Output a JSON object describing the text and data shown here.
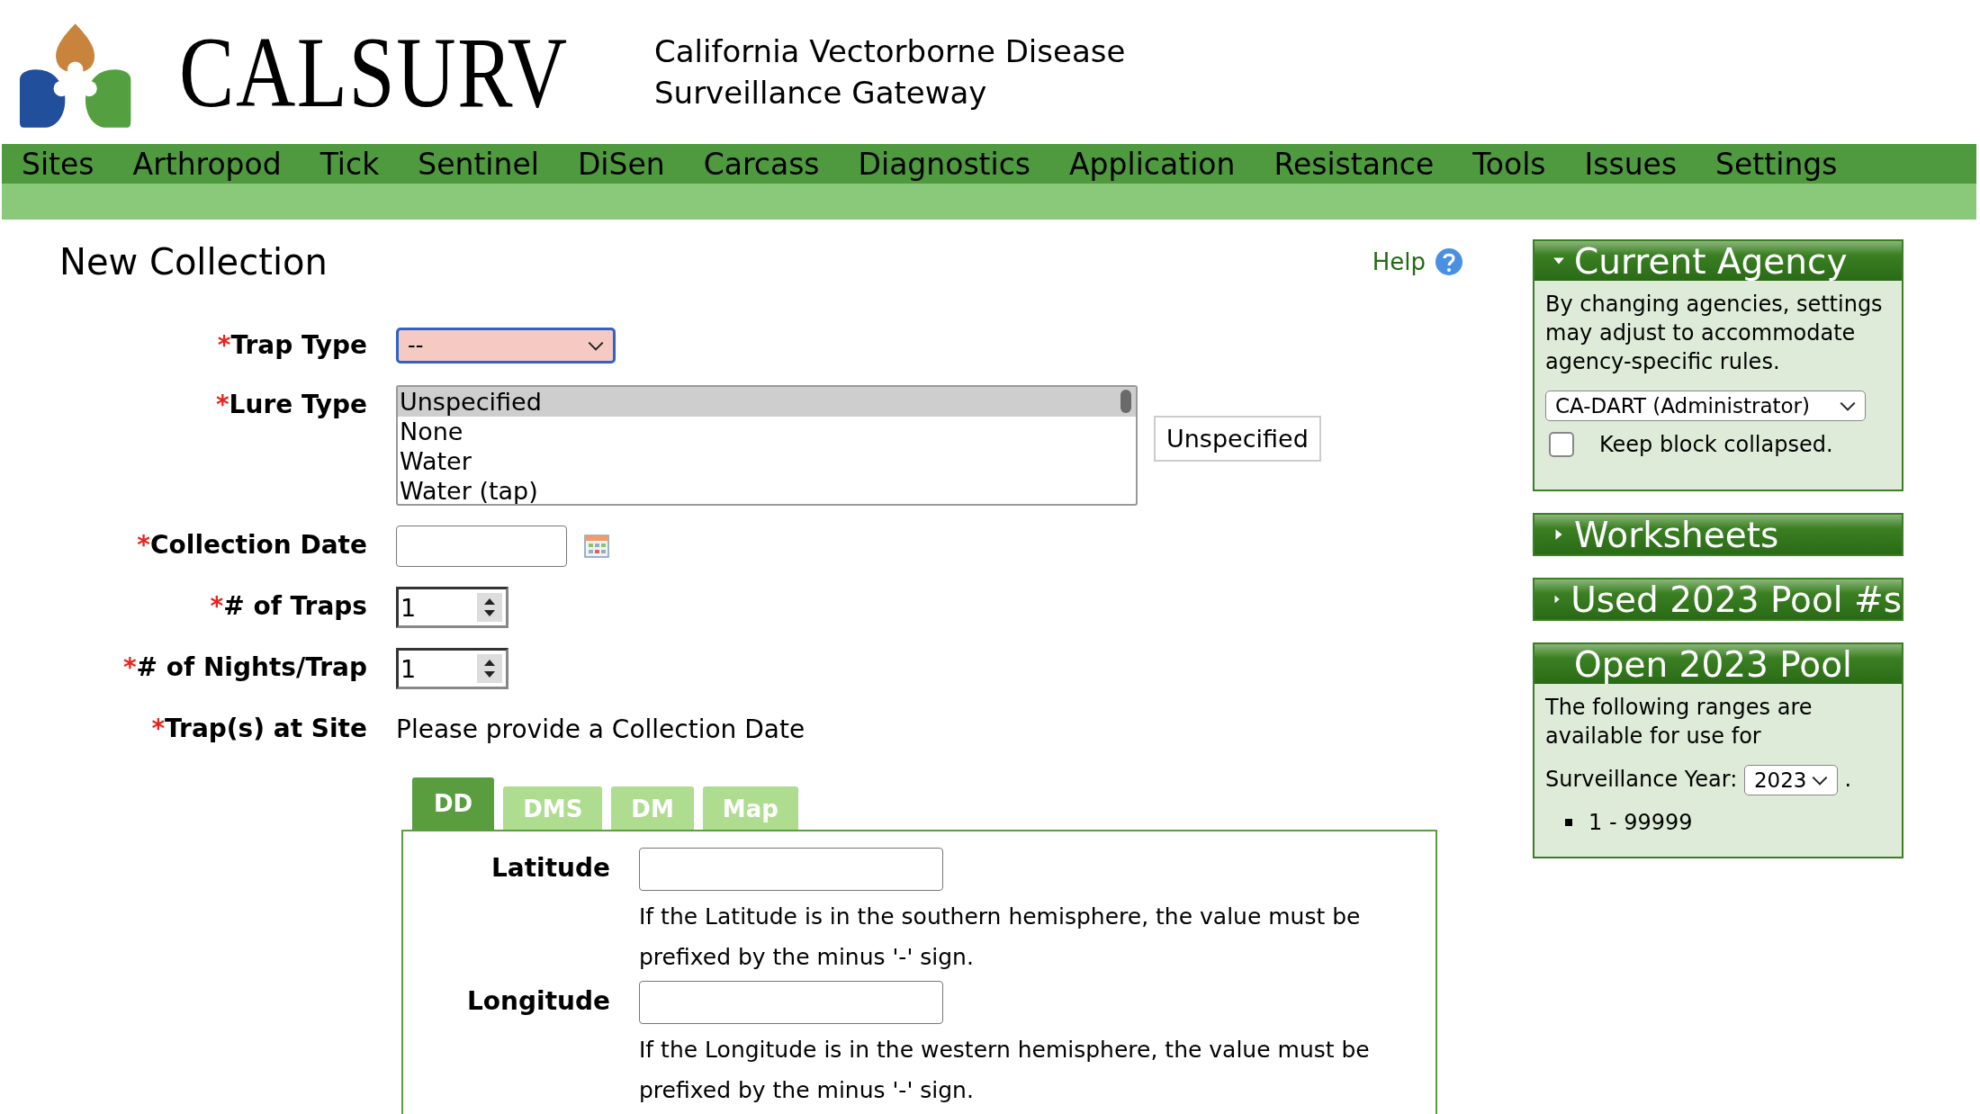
{
  "header": {
    "logo_text": "CALSURV",
    "subtitle_lines": [
      "California Vectorborne Disease",
      "Surveillance Gateway"
    ]
  },
  "nav": [
    {
      "label": "Sites"
    },
    {
      "label": "Arthropod"
    },
    {
      "label": "Tick"
    },
    {
      "label": "Sentinel"
    },
    {
      "label": "DiSen"
    },
    {
      "label": "Carcass"
    },
    {
      "label": "Diagnostics"
    },
    {
      "label": "Application"
    },
    {
      "label": "Resistance"
    },
    {
      "label": "Tools"
    },
    {
      "label": "Issues"
    },
    {
      "label": "Settings"
    }
  ],
  "page": {
    "title": "New Collection",
    "help": "Help"
  },
  "form": {
    "required_mark": "*",
    "trap_type": {
      "label": "Trap Type",
      "value": "--",
      "invalid": true
    },
    "lure_type": {
      "label": "Lure Type",
      "options": [
        {
          "label": "Unspecified",
          "selected": true
        },
        {
          "label": "None",
          "selected": false
        },
        {
          "label": "Water",
          "selected": false
        },
        {
          "label": "Water (tap)",
          "selected": false
        }
      ],
      "button": "Unspecified"
    },
    "collection_date": {
      "label": "Collection Date"
    },
    "traps": {
      "label": "# of Traps",
      "value": "1"
    },
    "nights": {
      "label": "# of Nights/Trap",
      "value": "1"
    },
    "traps_at_site": {
      "label": "Trap(s) at Site",
      "message": "Please provide a Collection Date"
    }
  },
  "coord_tabs": [
    {
      "label": "DD",
      "selected": true
    },
    {
      "label": "DMS",
      "selected": false
    },
    {
      "label": "DM",
      "selected": false
    },
    {
      "label": "Map",
      "selected": false
    }
  ],
  "coords": [
    {
      "label": "Latitude",
      "help": "If the Latitude is in the southern hemisphere, the value must be prefixed by the minus '-' sign."
    },
    {
      "label": "Longitude",
      "help": "If the Longitude is in the western hemisphere, the value must be prefixed by the minus '-' sign."
    }
  ],
  "sidebar": [
    {
      "kind": "agency",
      "title": "Current Agency",
      "expanded": true,
      "text": "By changing agencies, settings may adjust to accommodate agency-specific rules.",
      "select": "CA-DART (Administrator)",
      "checkbox": {
        "label": "Keep block collapsed.",
        "checked": false
      }
    },
    {
      "kind": "collapsed",
      "title": "Worksheets",
      "expanded": false
    },
    {
      "kind": "collapsed",
      "title": "Used 2023 Pool #s",
      "expanded": false
    },
    {
      "kind": "pool",
      "title": "Open 2023 Pool",
      "text": "The following ranges are available for use for",
      "year_label": "Surveillance Year:",
      "year": "2023",
      "after": ".",
      "ranges": [
        "1 - 99999"
      ]
    }
  ]
}
